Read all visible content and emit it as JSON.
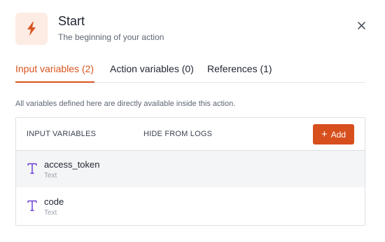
{
  "header": {
    "title": "Start",
    "subtitle": "The beginning of your action",
    "accent_color": "#d9541f",
    "icon": "lightning-icon",
    "close_icon": "close-icon"
  },
  "tabs": [
    {
      "label": "Input variables (2)",
      "active": true
    },
    {
      "label": "Action variables (0)",
      "active": false
    },
    {
      "label": "References (1)",
      "active": false
    }
  ],
  "description": "All variables defined here are directly available inside this action.",
  "table": {
    "columns": [
      "INPUT VARIABLES",
      "HIDE FROM LOGS"
    ],
    "add_button": {
      "icon": "plus-icon",
      "label": "Add"
    },
    "rows": [
      {
        "name": "access_token",
        "type": "Text",
        "type_icon": "text-type-icon"
      },
      {
        "name": "code",
        "type": "Text",
        "type_icon": "text-type-icon"
      }
    ]
  }
}
